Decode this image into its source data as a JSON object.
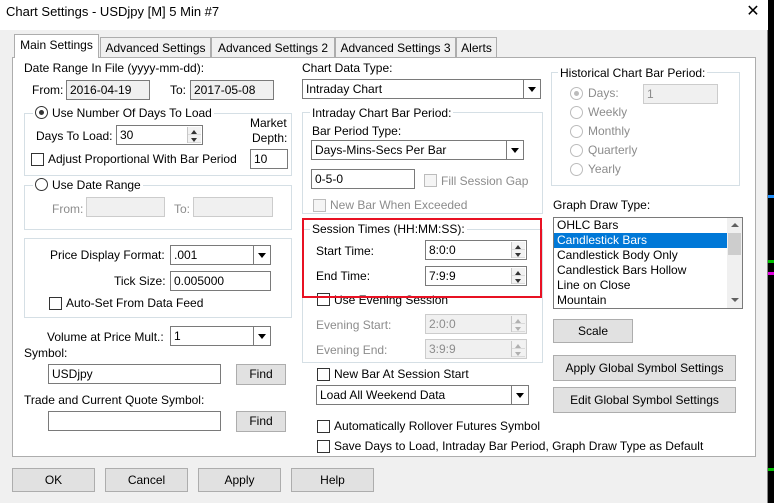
{
  "window": {
    "title": "Chart Settings - USDjpy [M]  5 Min  #7",
    "close_glyph": "✕"
  },
  "tabs": [
    {
      "label": "Main Settings"
    },
    {
      "label": "Advanced Settings"
    },
    {
      "label": "Advanced Settings 2"
    },
    {
      "label": "Advanced Settings 3"
    },
    {
      "label": "Alerts"
    }
  ],
  "date_range": {
    "label": "Date Range In File (yyyy-mm-dd):",
    "from_label": "From:",
    "from_value": "2016-04-19",
    "to_label": "To:",
    "to_value": "2017-05-08"
  },
  "days_group": {
    "radio_label": "Use Number Of Days To Load",
    "days_label": "Days To Load:",
    "days_value": "30",
    "market_depth_label_1": "Market",
    "market_depth_label_2": "Depth:",
    "market_depth_value": "10",
    "adjust_label": "Adjust Proportional With Bar Period"
  },
  "date_range_group": {
    "radio_label": "Use Date Range",
    "from_label": "From:",
    "to_label": "To:",
    "from_value": "",
    "to_value": ""
  },
  "price": {
    "display_format_label": "Price Display Format:",
    "display_format_value": ".001",
    "tick_size_label": "Tick Size:",
    "tick_size_value": "0.005000",
    "autoset_label": "Auto-Set From Data Feed"
  },
  "volume": {
    "label": "Volume at Price Mult.:",
    "value": "1"
  },
  "symbol": {
    "label": "Symbol:",
    "value": "USDjpy",
    "find_label": "Find"
  },
  "trade_quote": {
    "label": "Trade and Current Quote Symbol:",
    "value": "",
    "find_label": "Find"
  },
  "chart_data_type": {
    "label": "Chart Data Type:",
    "value": "Intraday Chart"
  },
  "intraday": {
    "group_label": "Intraday Chart Bar Period:",
    "bar_period_type_label": "Bar Period Type:",
    "bar_period_type_value": "Days-Mins-Secs Per Bar",
    "period_value": "0-5-0",
    "fill_gap_label": "Fill Session Gap",
    "new_bar_exceeded_label": "New Bar When Exceeded"
  },
  "session": {
    "group_label": "Session Times (HH:MM:SS):",
    "start_label": "Start Time:",
    "start_value": "8:0:0",
    "end_label": "End Time:",
    "end_value": "7:9:9",
    "use_evening_label": "Use Evening Session",
    "evening_start_label": "Evening Start:",
    "evening_start_value": "2:0:0",
    "evening_end_label": "Evening End:",
    "evening_end_value": "3:9:9",
    "new_bar_session_label": "New Bar At Session Start",
    "weekend_value": "Load All Weekend Data"
  },
  "options": {
    "rollover_label": "Automatically Rollover Futures Symbol",
    "save_default_label": "Save Days to Load, Intraday Bar Period, Graph Draw Type as Default"
  },
  "historical": {
    "group_label": "Historical Chart Bar Period:",
    "options": [
      "Days:",
      "Weekly",
      "Monthly",
      "Quarterly",
      "Yearly"
    ],
    "days_value": "1"
  },
  "graph_draw": {
    "label": "Graph Draw Type:",
    "items": [
      "OHLC Bars",
      "Candlestick Bars",
      "Candlestick Body Only",
      "Candlestick Bars Hollow",
      "Line on Close",
      "Mountain"
    ],
    "selected": "Candlestick Bars"
  },
  "buttons": {
    "scale": "Scale",
    "apply_global": "Apply Global Symbol Settings",
    "edit_global": "Edit Global Symbol Settings",
    "ok": "OK",
    "cancel": "Cancel",
    "apply": "Apply",
    "help": "Help"
  },
  "colors": {
    "selection": "#0078d7",
    "highlight_box": "#e81123"
  }
}
